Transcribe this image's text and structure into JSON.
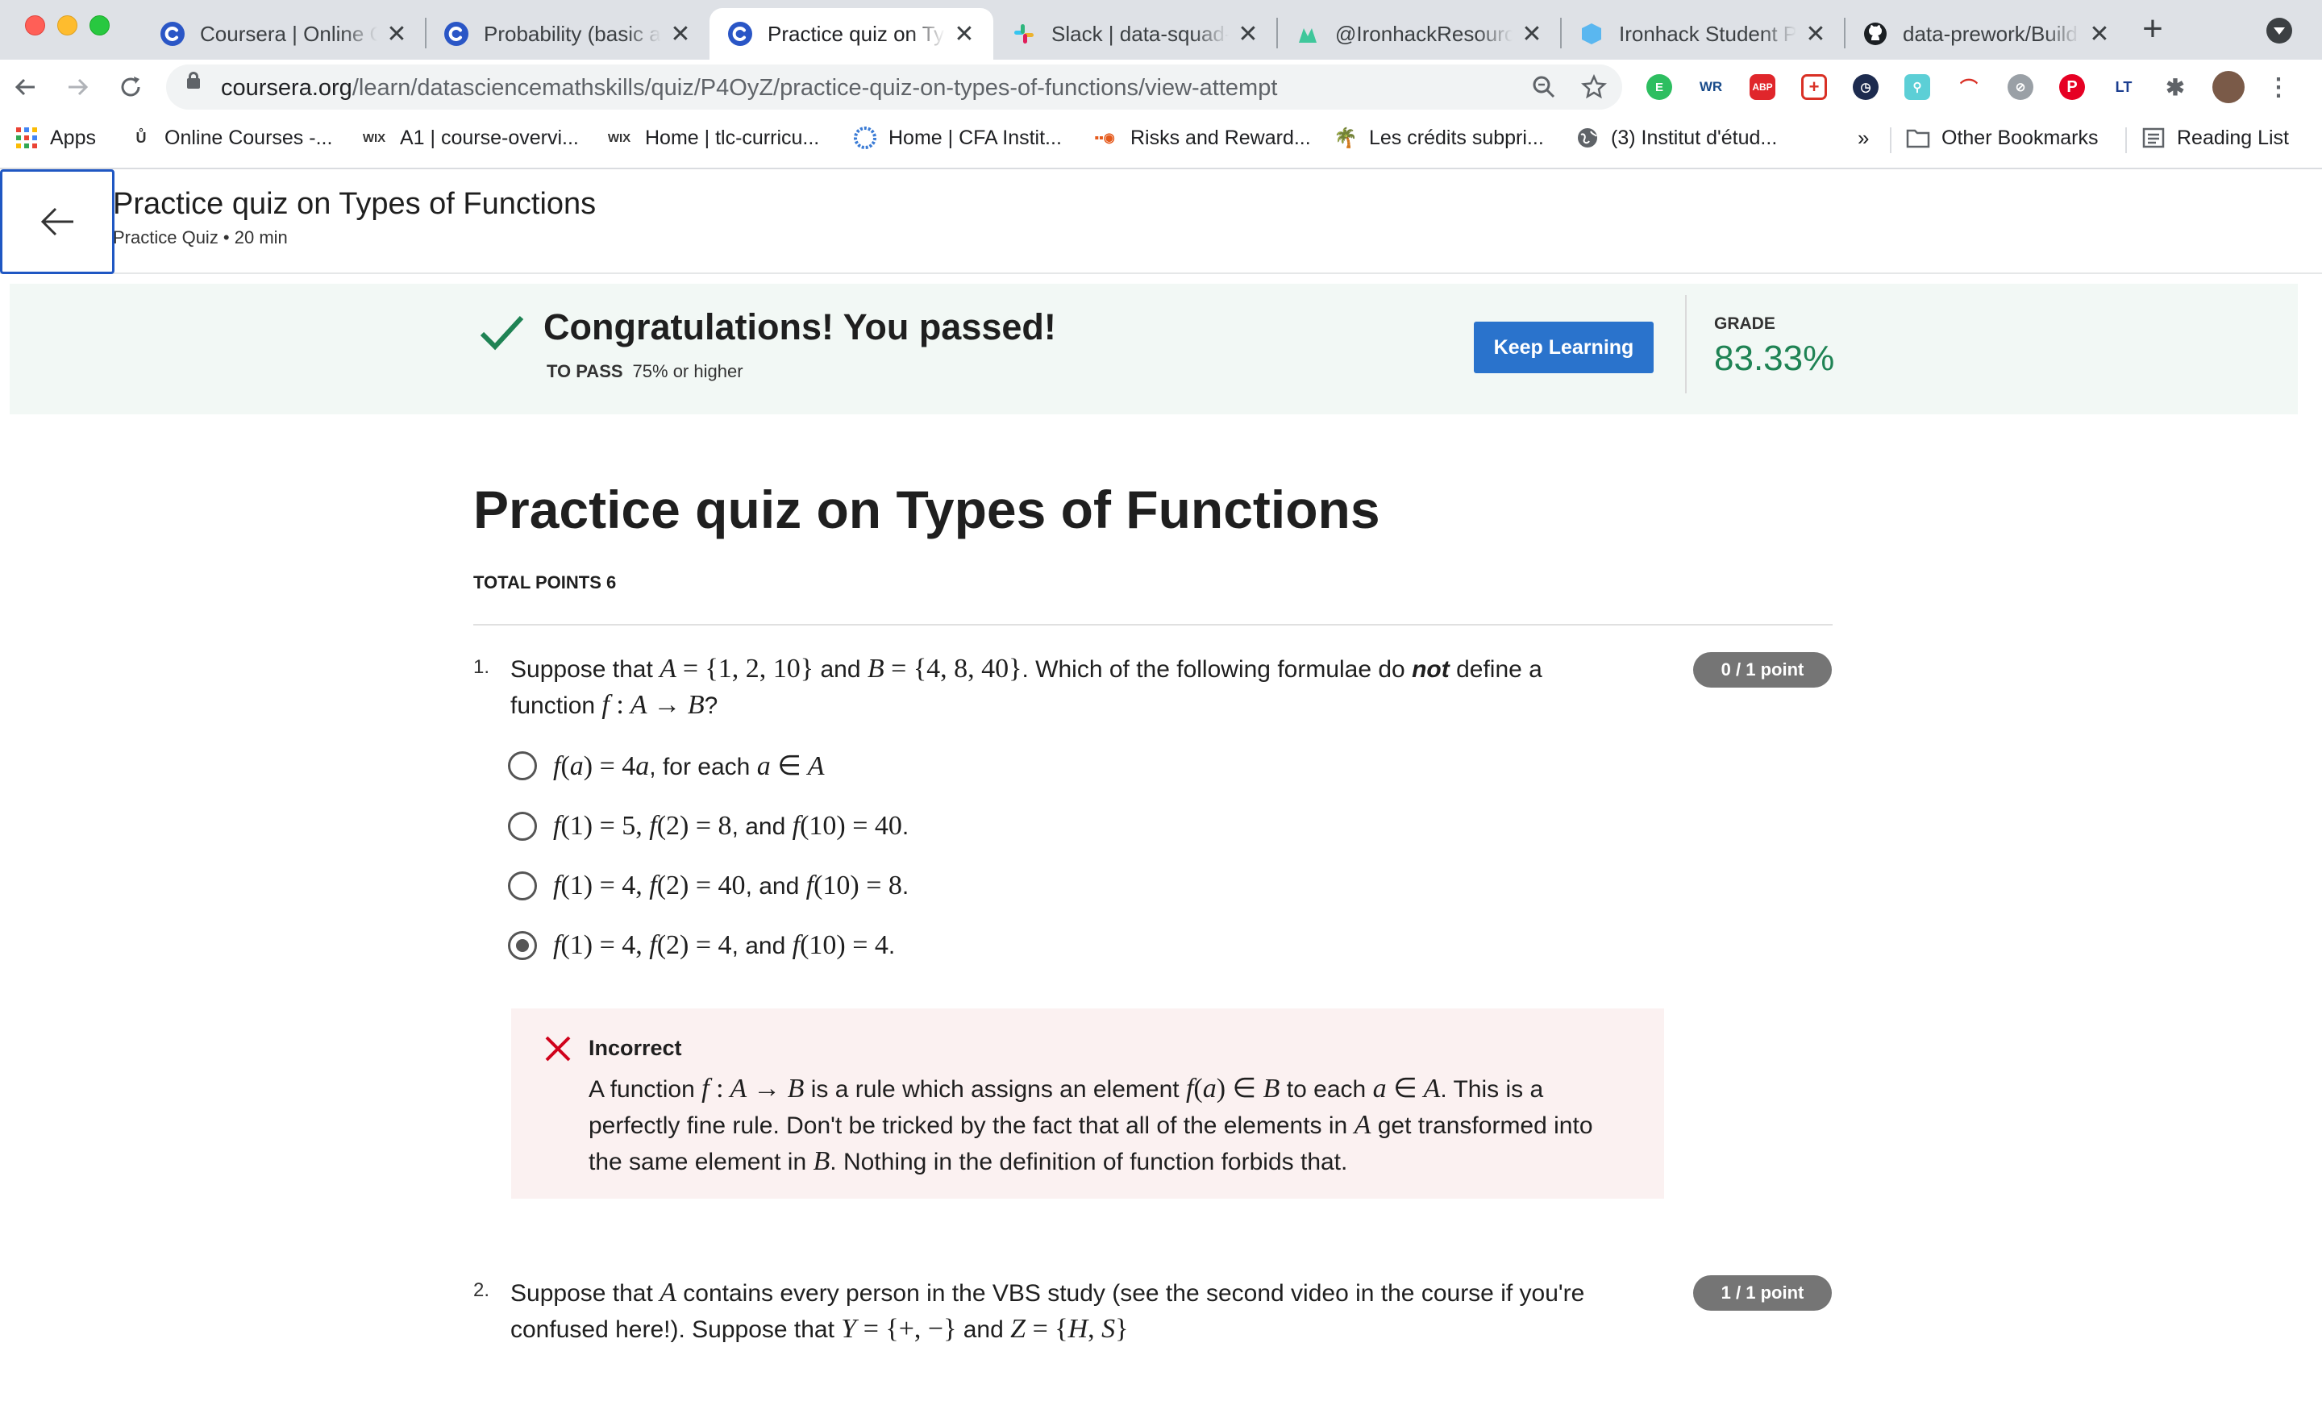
{
  "browser": {
    "tabs": [
      {
        "title": "Coursera | Online Courses",
        "icon": "coursera-icon"
      },
      {
        "title": "Probability (basic and...",
        "icon": "coursera-icon"
      },
      {
        "title": "Practice quiz on Types...",
        "icon": "coursera-icon",
        "active": true
      },
      {
        "title": "Slack | data-squad-...",
        "icon": "slack-icon"
      },
      {
        "title": "@IronhackResources",
        "icon": "ironhack-icon"
      },
      {
        "title": "Ironhack Student Portal",
        "icon": "ironhack-student-icon"
      },
      {
        "title": "data-prework/Build...",
        "icon": "github-icon"
      }
    ],
    "close_glyph": "✕",
    "new_tab_glyph": "+",
    "url": {
      "host": "coursera.org",
      "path": "/learn/datasciencemathskills/quiz/P4OyZ/practice-quiz-on-types-of-functions/view-attempt"
    },
    "bookmarks": [
      {
        "label": "Apps",
        "icon": "apps-grid-icon"
      },
      {
        "label": "Online Courses -...",
        "icon": "u-icon"
      },
      {
        "label": "A1 | course-overvi...",
        "icon": "wix-icon"
      },
      {
        "label": "Home | tlc-curricu...",
        "icon": "wix-icon"
      },
      {
        "label": "Home | CFA Instit...",
        "icon": "cfa-icon"
      },
      {
        "label": "Risks and Reward...",
        "icon": "risks-icon"
      },
      {
        "label": "Les crédits subpri...",
        "icon": "palm-icon"
      },
      {
        "label": "(3) Institut d'étud...",
        "icon": "globe-icon"
      }
    ],
    "more_glyph": "»",
    "other_bookmarks": "Other Bookmarks",
    "reading_list": "Reading List"
  },
  "header": {
    "title": "Practice quiz on Types of Functions",
    "subtitle": "Practice Quiz • 20 min"
  },
  "banner": {
    "message": "Congratulations! You passed!",
    "to_pass_label": "TO PASS",
    "to_pass_value": "75% or higher",
    "keep_learning": "Keep Learning",
    "grade_label": "GRADE",
    "grade_value": "83.33%"
  },
  "quiz": {
    "title": "Practice quiz on Types of Functions",
    "total_points": "TOTAL POINTS 6",
    "q1": {
      "number": "1.",
      "badge": "0 / 1 point",
      "words": {
        "suppose": "Suppose that",
        "and": "and",
        "which": ". Which of the following formulae do",
        "not": "not",
        "define": "define a",
        "function": "function",
        "qmark": "?"
      },
      "options": [
        {
          "tail": ", for each",
          "checked": false
        },
        {
          "and": ", and",
          "end": ".",
          "checked": false
        },
        {
          "and": ", and",
          "end": ".",
          "checked": false
        },
        {
          "and": ", and",
          "end": ".",
          "checked": true
        }
      ],
      "feedback": {
        "status": "Incorrect",
        "p1": "A function",
        "p2": "is a rule which assigns an element",
        "p3": "to each",
        "p4": ". This is a perfectly fine rule. Don't be tricked by the fact that all of the elements in",
        "p5": "get transformed into the same element in",
        "p6": ". Nothing in the definition of function forbids that."
      }
    },
    "q2": {
      "number": "2.",
      "badge": "1 / 1 point",
      "p1": "Suppose that",
      "p2": "contains every person in the VBS study (see the second video in the course if you're confused here!). Suppose that",
      "p3": "and"
    }
  },
  "colors": {
    "accent": "#2a73cc",
    "success": "#1f8354",
    "error": "#d0021b",
    "badge": "#757575"
  }
}
